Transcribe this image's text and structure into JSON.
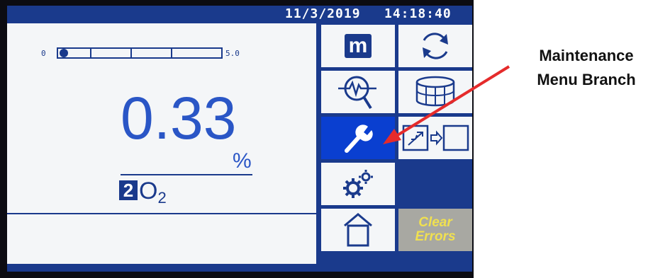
{
  "status_bar": {
    "date": "11/3/2019",
    "time": "14:18:40"
  },
  "reading_panel": {
    "range_low": "0",
    "range_high": "5.0",
    "bar_level": 0.0,
    "value": "0.33",
    "unit": "%",
    "channel_number": "2",
    "gas_symbol": "O",
    "gas_subscript": "2"
  },
  "menu": {
    "tiles": [
      {
        "name": "main-menu",
        "icon": "m-letter-icon",
        "label": "m"
      },
      {
        "name": "refresh",
        "icon": "refresh-arrows-icon"
      },
      {
        "name": "diagnostics",
        "icon": "magnifier-waveform-icon"
      },
      {
        "name": "database",
        "icon": "layered-database-icon"
      },
      {
        "name": "maintenance",
        "icon": "wrench-icon",
        "active": true
      },
      {
        "name": "data-export",
        "icon": "usb-to-box-icon"
      },
      {
        "name": "settings",
        "icon": "gears-icon"
      },
      {
        "name": "home",
        "icon": "home-icon"
      },
      {
        "name": "clear-errors",
        "label_line1": "Clear",
        "label_line2": "Errors"
      }
    ]
  },
  "annotation": {
    "line1": "Maintenance",
    "line2": "Menu Branch"
  },
  "colors": {
    "screen_blue": "#1a3a8c",
    "active_tile": "#0a3fd0",
    "reading_blue": "#2a56c6",
    "clear_errors_text": "#f0e050",
    "arrow_red": "#e52b2b"
  }
}
